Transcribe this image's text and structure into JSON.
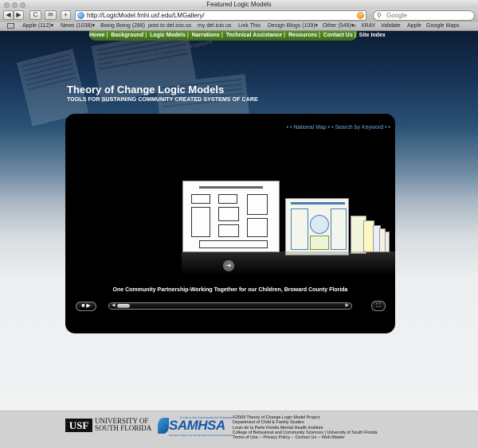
{
  "browser": {
    "window_title": "Featured Logic Models",
    "url": "http://LogicModel.fmhi.usf.edu/LMGallery/",
    "search_placeholder": "Google",
    "back_icon": "◀",
    "forward_icon": "▶",
    "reload_icon": "C",
    "newtab_icon": "+",
    "bookmarks": [
      "Apple (112)▾",
      "News (1038)▾",
      "Boing Boing (288)",
      "post to del.icio.us",
      "my del.icio.us",
      "Link This",
      "Design Blogs (109)▾",
      "Other (549)▾",
      "»",
      "XRAY",
      "Validate",
      "Apple",
      "Google Maps"
    ]
  },
  "site": {
    "nav": [
      "Home",
      "Background",
      "Logic Models",
      "Narrations",
      "Technical Assistance",
      "Resources",
      "Contact Us",
      "Site Index"
    ],
    "title": "Theory of Change Logic Models",
    "subtitle": "TOOLS FOR SUSTAINING COMMUNITY CREATED SYSTEMS OF CARE",
    "collage_text": "Goal: Develop SOC infrastructure"
  },
  "gallery": {
    "national_map": "National Map",
    "search_by_keyword": "Search by Keyword",
    "link_prefix": "• •",
    "caption": "One Community Partnership-Working Together for our Children, Broward County Florida",
    "play_label": "■ ▶",
    "scroll_left": "◀",
    "scroll_right": "▶",
    "fullscreen_label": "⛶",
    "overlay_icon": "➜"
  },
  "footer": {
    "usf_box": "USF",
    "usf_line1": "UNIVERSITY OF",
    "usf_line2": "SOUTH FLORIDA",
    "samhsa_tagline": "A Life in the Community for Everyone",
    "samhsa": "SAMHSA",
    "samhsa_sub": "Substance Abuse and Mental Health Services Administration",
    "credits": [
      "©2009 Theory of Change Logic Model Project",
      "Department of Child & Family Studies",
      "Louis de la Parte Florida Mental Health Institute",
      "College of Behavioral and Community Sciences | University of South Florida",
      "Terms of Use -- Privacy Policy -- Contact Us -- Web Master"
    ]
  },
  "colors": {
    "nav_green": "#4a7d22",
    "page_navy": "#0d1c33",
    "link_blue": "#6fa4d6",
    "samhsa_blue": "#1558a8"
  }
}
